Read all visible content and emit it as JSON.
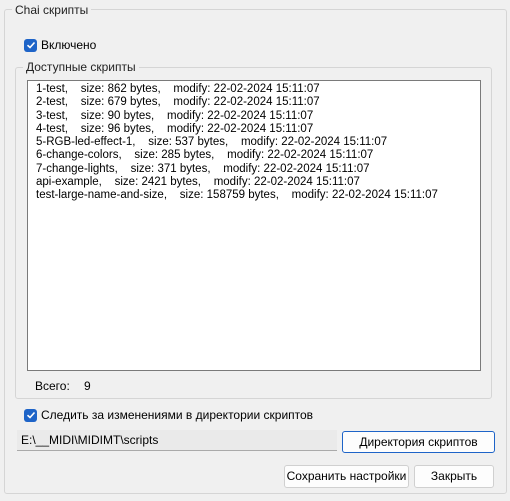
{
  "group": {
    "title": "Chai скрипты"
  },
  "enabled": {
    "label": "Включено",
    "checked": true
  },
  "scripts_group": {
    "title": "Доступные скрипты"
  },
  "scripts": [
    "1-test,    size: 862 bytes,    modify: 22-02-2024 15:11:07",
    "2-test,    size: 679 bytes,    modify: 22-02-2024 15:11:07",
    "3-test,    size: 90 bytes,    modify: 22-02-2024 15:11:07",
    "4-test,    size: 96 bytes,    modify: 22-02-2024 15:11:07",
    "5-RGB-led-effect-1,    size: 537 bytes,    modify: 22-02-2024 15:11:07",
    "6-change-colors,    size: 285 bytes,    modify: 22-02-2024 15:11:07",
    "7-change-lights,    size: 371 bytes,    modify: 22-02-2024 15:11:07",
    "api-example,    size: 2421 bytes,    modify: 22-02-2024 15:11:07",
    "test-large-name-and-size,    size: 158759 bytes,    modify: 22-02-2024 15:11:07"
  ],
  "total": {
    "label": "Всего:",
    "value": "9"
  },
  "watch": {
    "label": "Следить за изменениями в директории скриптов",
    "checked": true
  },
  "path": {
    "value": "E:\\__MIDI\\MIDIMT\\scripts"
  },
  "buttons": {
    "directory": "Директория скриптов",
    "save": "Сохранить настройки",
    "close": "Закрыть"
  },
  "colors": {
    "accent": "#1e64c8"
  }
}
